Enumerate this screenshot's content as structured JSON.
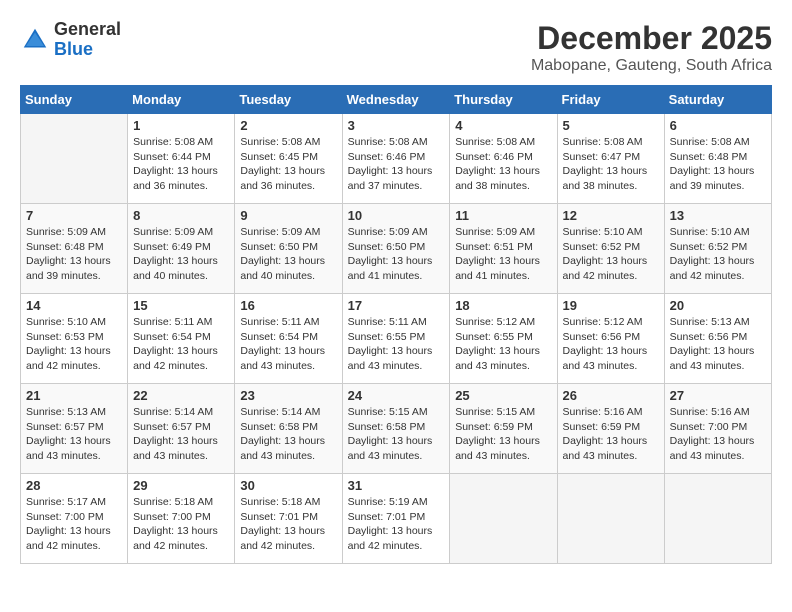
{
  "header": {
    "logo": {
      "general": "General",
      "blue": "Blue"
    },
    "month_year": "December 2025",
    "location": "Mabopane, Gauteng, South Africa"
  },
  "calendar": {
    "days_of_week": [
      "Sunday",
      "Monday",
      "Tuesday",
      "Wednesday",
      "Thursday",
      "Friday",
      "Saturday"
    ],
    "weeks": [
      [
        {
          "day": "",
          "info": ""
        },
        {
          "day": "1",
          "info": "Sunrise: 5:08 AM\nSunset: 6:44 PM\nDaylight: 13 hours\nand 36 minutes."
        },
        {
          "day": "2",
          "info": "Sunrise: 5:08 AM\nSunset: 6:45 PM\nDaylight: 13 hours\nand 36 minutes."
        },
        {
          "day": "3",
          "info": "Sunrise: 5:08 AM\nSunset: 6:46 PM\nDaylight: 13 hours\nand 37 minutes."
        },
        {
          "day": "4",
          "info": "Sunrise: 5:08 AM\nSunset: 6:46 PM\nDaylight: 13 hours\nand 38 minutes."
        },
        {
          "day": "5",
          "info": "Sunrise: 5:08 AM\nSunset: 6:47 PM\nDaylight: 13 hours\nand 38 minutes."
        },
        {
          "day": "6",
          "info": "Sunrise: 5:08 AM\nSunset: 6:48 PM\nDaylight: 13 hours\nand 39 minutes."
        }
      ],
      [
        {
          "day": "7",
          "info": "Sunrise: 5:09 AM\nSunset: 6:48 PM\nDaylight: 13 hours\nand 39 minutes."
        },
        {
          "day": "8",
          "info": "Sunrise: 5:09 AM\nSunset: 6:49 PM\nDaylight: 13 hours\nand 40 minutes."
        },
        {
          "day": "9",
          "info": "Sunrise: 5:09 AM\nSunset: 6:50 PM\nDaylight: 13 hours\nand 40 minutes."
        },
        {
          "day": "10",
          "info": "Sunrise: 5:09 AM\nSunset: 6:50 PM\nDaylight: 13 hours\nand 41 minutes."
        },
        {
          "day": "11",
          "info": "Sunrise: 5:09 AM\nSunset: 6:51 PM\nDaylight: 13 hours\nand 41 minutes."
        },
        {
          "day": "12",
          "info": "Sunrise: 5:10 AM\nSunset: 6:52 PM\nDaylight: 13 hours\nand 42 minutes."
        },
        {
          "day": "13",
          "info": "Sunrise: 5:10 AM\nSunset: 6:52 PM\nDaylight: 13 hours\nand 42 minutes."
        }
      ],
      [
        {
          "day": "14",
          "info": "Sunrise: 5:10 AM\nSunset: 6:53 PM\nDaylight: 13 hours\nand 42 minutes."
        },
        {
          "day": "15",
          "info": "Sunrise: 5:11 AM\nSunset: 6:54 PM\nDaylight: 13 hours\nand 42 minutes."
        },
        {
          "day": "16",
          "info": "Sunrise: 5:11 AM\nSunset: 6:54 PM\nDaylight: 13 hours\nand 43 minutes."
        },
        {
          "day": "17",
          "info": "Sunrise: 5:11 AM\nSunset: 6:55 PM\nDaylight: 13 hours\nand 43 minutes."
        },
        {
          "day": "18",
          "info": "Sunrise: 5:12 AM\nSunset: 6:55 PM\nDaylight: 13 hours\nand 43 minutes."
        },
        {
          "day": "19",
          "info": "Sunrise: 5:12 AM\nSunset: 6:56 PM\nDaylight: 13 hours\nand 43 minutes."
        },
        {
          "day": "20",
          "info": "Sunrise: 5:13 AM\nSunset: 6:56 PM\nDaylight: 13 hours\nand 43 minutes."
        }
      ],
      [
        {
          "day": "21",
          "info": "Sunrise: 5:13 AM\nSunset: 6:57 PM\nDaylight: 13 hours\nand 43 minutes."
        },
        {
          "day": "22",
          "info": "Sunrise: 5:14 AM\nSunset: 6:57 PM\nDaylight: 13 hours\nand 43 minutes."
        },
        {
          "day": "23",
          "info": "Sunrise: 5:14 AM\nSunset: 6:58 PM\nDaylight: 13 hours\nand 43 minutes."
        },
        {
          "day": "24",
          "info": "Sunrise: 5:15 AM\nSunset: 6:58 PM\nDaylight: 13 hours\nand 43 minutes."
        },
        {
          "day": "25",
          "info": "Sunrise: 5:15 AM\nSunset: 6:59 PM\nDaylight: 13 hours\nand 43 minutes."
        },
        {
          "day": "26",
          "info": "Sunrise: 5:16 AM\nSunset: 6:59 PM\nDaylight: 13 hours\nand 43 minutes."
        },
        {
          "day": "27",
          "info": "Sunrise: 5:16 AM\nSunset: 7:00 PM\nDaylight: 13 hours\nand 43 minutes."
        }
      ],
      [
        {
          "day": "28",
          "info": "Sunrise: 5:17 AM\nSunset: 7:00 PM\nDaylight: 13 hours\nand 42 minutes."
        },
        {
          "day": "29",
          "info": "Sunrise: 5:18 AM\nSunset: 7:00 PM\nDaylight: 13 hours\nand 42 minutes."
        },
        {
          "day": "30",
          "info": "Sunrise: 5:18 AM\nSunset: 7:01 PM\nDaylight: 13 hours\nand 42 minutes."
        },
        {
          "day": "31",
          "info": "Sunrise: 5:19 AM\nSunset: 7:01 PM\nDaylight: 13 hours\nand 42 minutes."
        },
        {
          "day": "",
          "info": ""
        },
        {
          "day": "",
          "info": ""
        },
        {
          "day": "",
          "info": ""
        }
      ]
    ]
  }
}
